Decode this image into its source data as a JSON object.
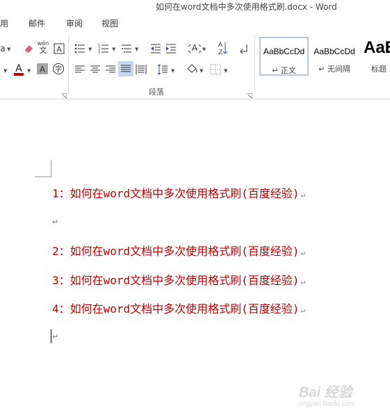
{
  "window": {
    "title": "如何在word文档中多次使用格式刷.docx - Word"
  },
  "menu": {
    "items": [
      "用",
      "邮件",
      "审阅",
      "视图"
    ]
  },
  "ribbon": {
    "groups": {
      "paragraph": "段落"
    },
    "pinyin_glyph": "wén",
    "pinyin_char": "文",
    "letter_a": "a",
    "sort_label": "A Z",
    "styles": [
      {
        "sample": "AaBbCcDd",
        "name": "↵ 正文"
      },
      {
        "sample": "AaBbCcDd",
        "name": "↵ 无间隔"
      },
      {
        "sample": "AaB",
        "name": "标题"
      }
    ]
  },
  "document": {
    "paragraphs": [
      "1：如何在word文档中多次使用格式刷(百度经验)",
      "",
      "2：如何在word文档中多次使用格式刷(百度经验)",
      "3：如何在word文档中多次使用格式刷(百度经验)",
      "4：如何在word文档中多次使用格式刷(百度经验)",
      ""
    ],
    "paragraph_mark": "↵",
    "text_color": "#c00000"
  },
  "watermark": {
    "logo": "Bai 经验",
    "url": "jingyan.baidu.com"
  },
  "icons": [
    "eraser-icon",
    "phonetic-guide-icon",
    "char-border-icon",
    "bullets-icon",
    "numbering-icon",
    "multilevel-list-icon",
    "decrease-indent-icon",
    "increase-indent-icon",
    "chinese-layout-icon",
    "sort-icon",
    "show-marks-icon",
    "font-color-icon",
    "char-shading-icon",
    "enclose-char-icon",
    "align-left-icon",
    "center-icon",
    "align-right-icon",
    "justify-icon",
    "distributed-icon",
    "line-spacing-icon",
    "shading-icon",
    "borders-icon"
  ]
}
